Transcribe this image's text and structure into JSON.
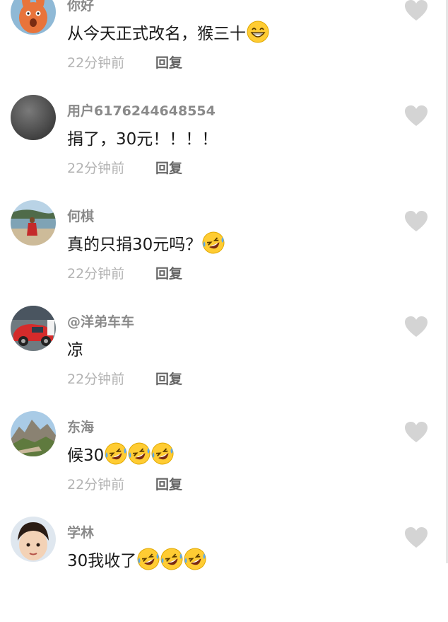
{
  "comments": [
    {
      "username": "你好",
      "text": "从今天正式改名，猴三十",
      "emojis": [
        "grinning-face"
      ],
      "time": "22分钟前",
      "reply_label": "回复",
      "avatar": "cartoon-rabbit"
    },
    {
      "username": "用户6176244648554",
      "text": "捐了，30元！！！！",
      "emojis": [],
      "time": "22分钟前",
      "reply_label": "回复",
      "avatar": "dark-gray-circle"
    },
    {
      "username": "何棋",
      "text": "真的只捐30元吗？",
      "emojis": [
        "rofl-face"
      ],
      "time": "22分钟前",
      "reply_label": "回复",
      "avatar": "beach-photo"
    },
    {
      "username": "@洋弟车车",
      "text": "凉",
      "emojis": [],
      "time": "22分钟前",
      "reply_label": "回复",
      "avatar": "red-car-photo"
    },
    {
      "username": "东海",
      "text": "候30",
      "emojis": [
        "rofl-face",
        "rofl-face",
        "rofl-face"
      ],
      "time": "22分钟前",
      "reply_label": "回复",
      "avatar": "mountain-photo"
    },
    {
      "username": "学林",
      "text": "30我收了",
      "emojis": [
        "rofl-face",
        "rofl-face",
        "rofl-face"
      ],
      "time": "",
      "reply_label": "",
      "avatar": "child-photo"
    }
  ],
  "icons": {
    "like": "heart-icon"
  },
  "colors": {
    "username": "#8a8a8a",
    "text": "#1a1a1a",
    "meta": "#b3b3b3",
    "reply": "#666666",
    "heart": "#d4d4d4"
  }
}
